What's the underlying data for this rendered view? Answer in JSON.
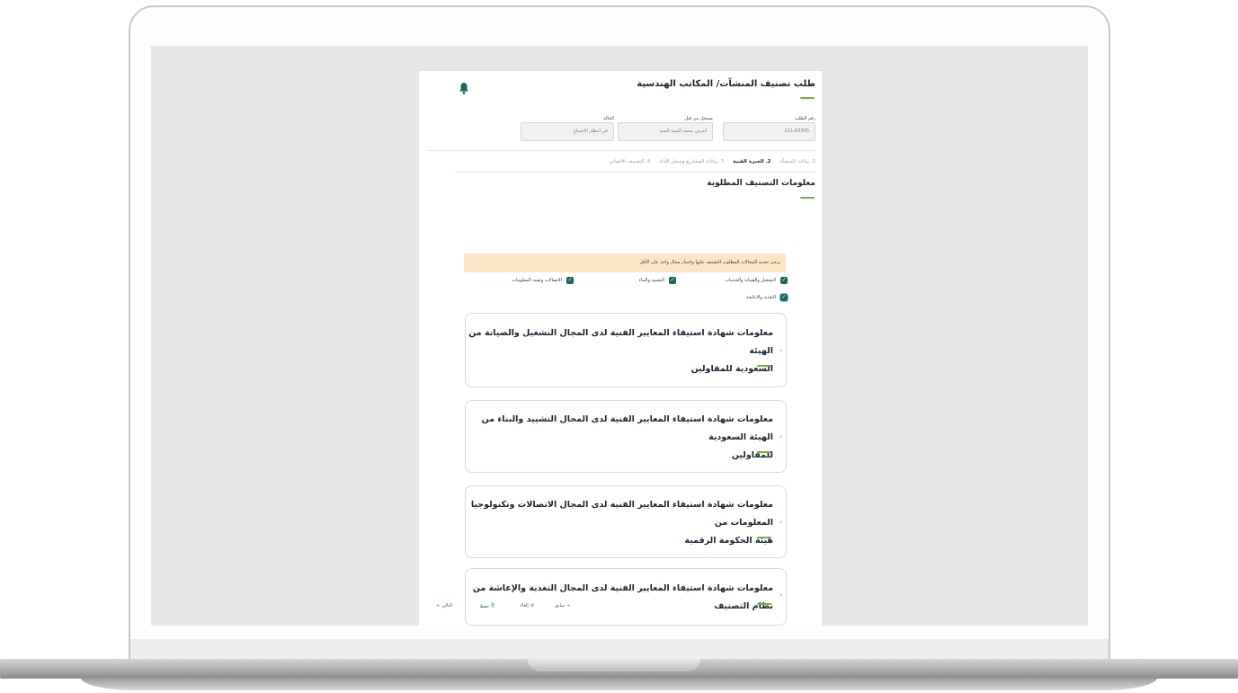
{
  "page": {
    "title": "طلب تصنيف المنشآت/ المكاتب الهندسية"
  },
  "fields": [
    {
      "label": "رقم الطلب",
      "value": "CCL-63305"
    },
    {
      "label": "مسجل من قبل",
      "value": "أشرف محمد السيد السيد"
    },
    {
      "label": "الحالة",
      "value": "في انتظار الاجتماع"
    }
  ],
  "steps": [
    {
      "label": "1. بيانات المنشأة"
    },
    {
      "label": "2. الخبرة الفنية"
    },
    {
      "label": "3. بيانات المشاريع وسجل الأداء"
    },
    {
      "label": "4. التصنيف الائتماني"
    }
  ],
  "section": {
    "title": "معلومات التصنيف المطلوبة"
  },
  "notice": "يرجى تحديد المجالات المطلوب التصنيف عليها واختيار مجال واحد على الأقل",
  "checkboxes": [
    {
      "label": "التشغيل والصيانة والخدمات"
    },
    {
      "label": "التشييد والبناء"
    },
    {
      "label": "الاتصالات وتقنية المعلومات"
    },
    {
      "label": "التغذية والاعاشة"
    }
  ],
  "cards": [
    {
      "line1": "معلومات شهادة استيفاء المعايير الفنية لدى المجال التشغيل والصيانة من الهيئة",
      "line2": "السعودية للمقاولين"
    },
    {
      "line1": "معلومات شهادة استيفاء المعايير الفنية لدى المجال التشييد والبناء من الهيئة السعودية",
      "line2": "للمقاولين"
    },
    {
      "line1": "معلومات شهادة استيفاء المعايير الفنية لدى المجال الاتصالات وتكنولوجيا المعلومات من",
      "line2": "هيئة الحكومة الرقمية"
    },
    {
      "line1": "معلومات شهادة استيفاء المعايير الفنية لدى المجال التغذية والإعاشة من نظام التصنيف",
      "line2": ""
    }
  ],
  "footer": {
    "next": "التالي ←",
    "save": "حفظ",
    "cancel": "إلغاء",
    "prev": "→ سابق"
  },
  "colors": {
    "accent_green": "#6db33f",
    "primary_teal": "#16695c",
    "notice_bg": "#fbe5c4"
  }
}
